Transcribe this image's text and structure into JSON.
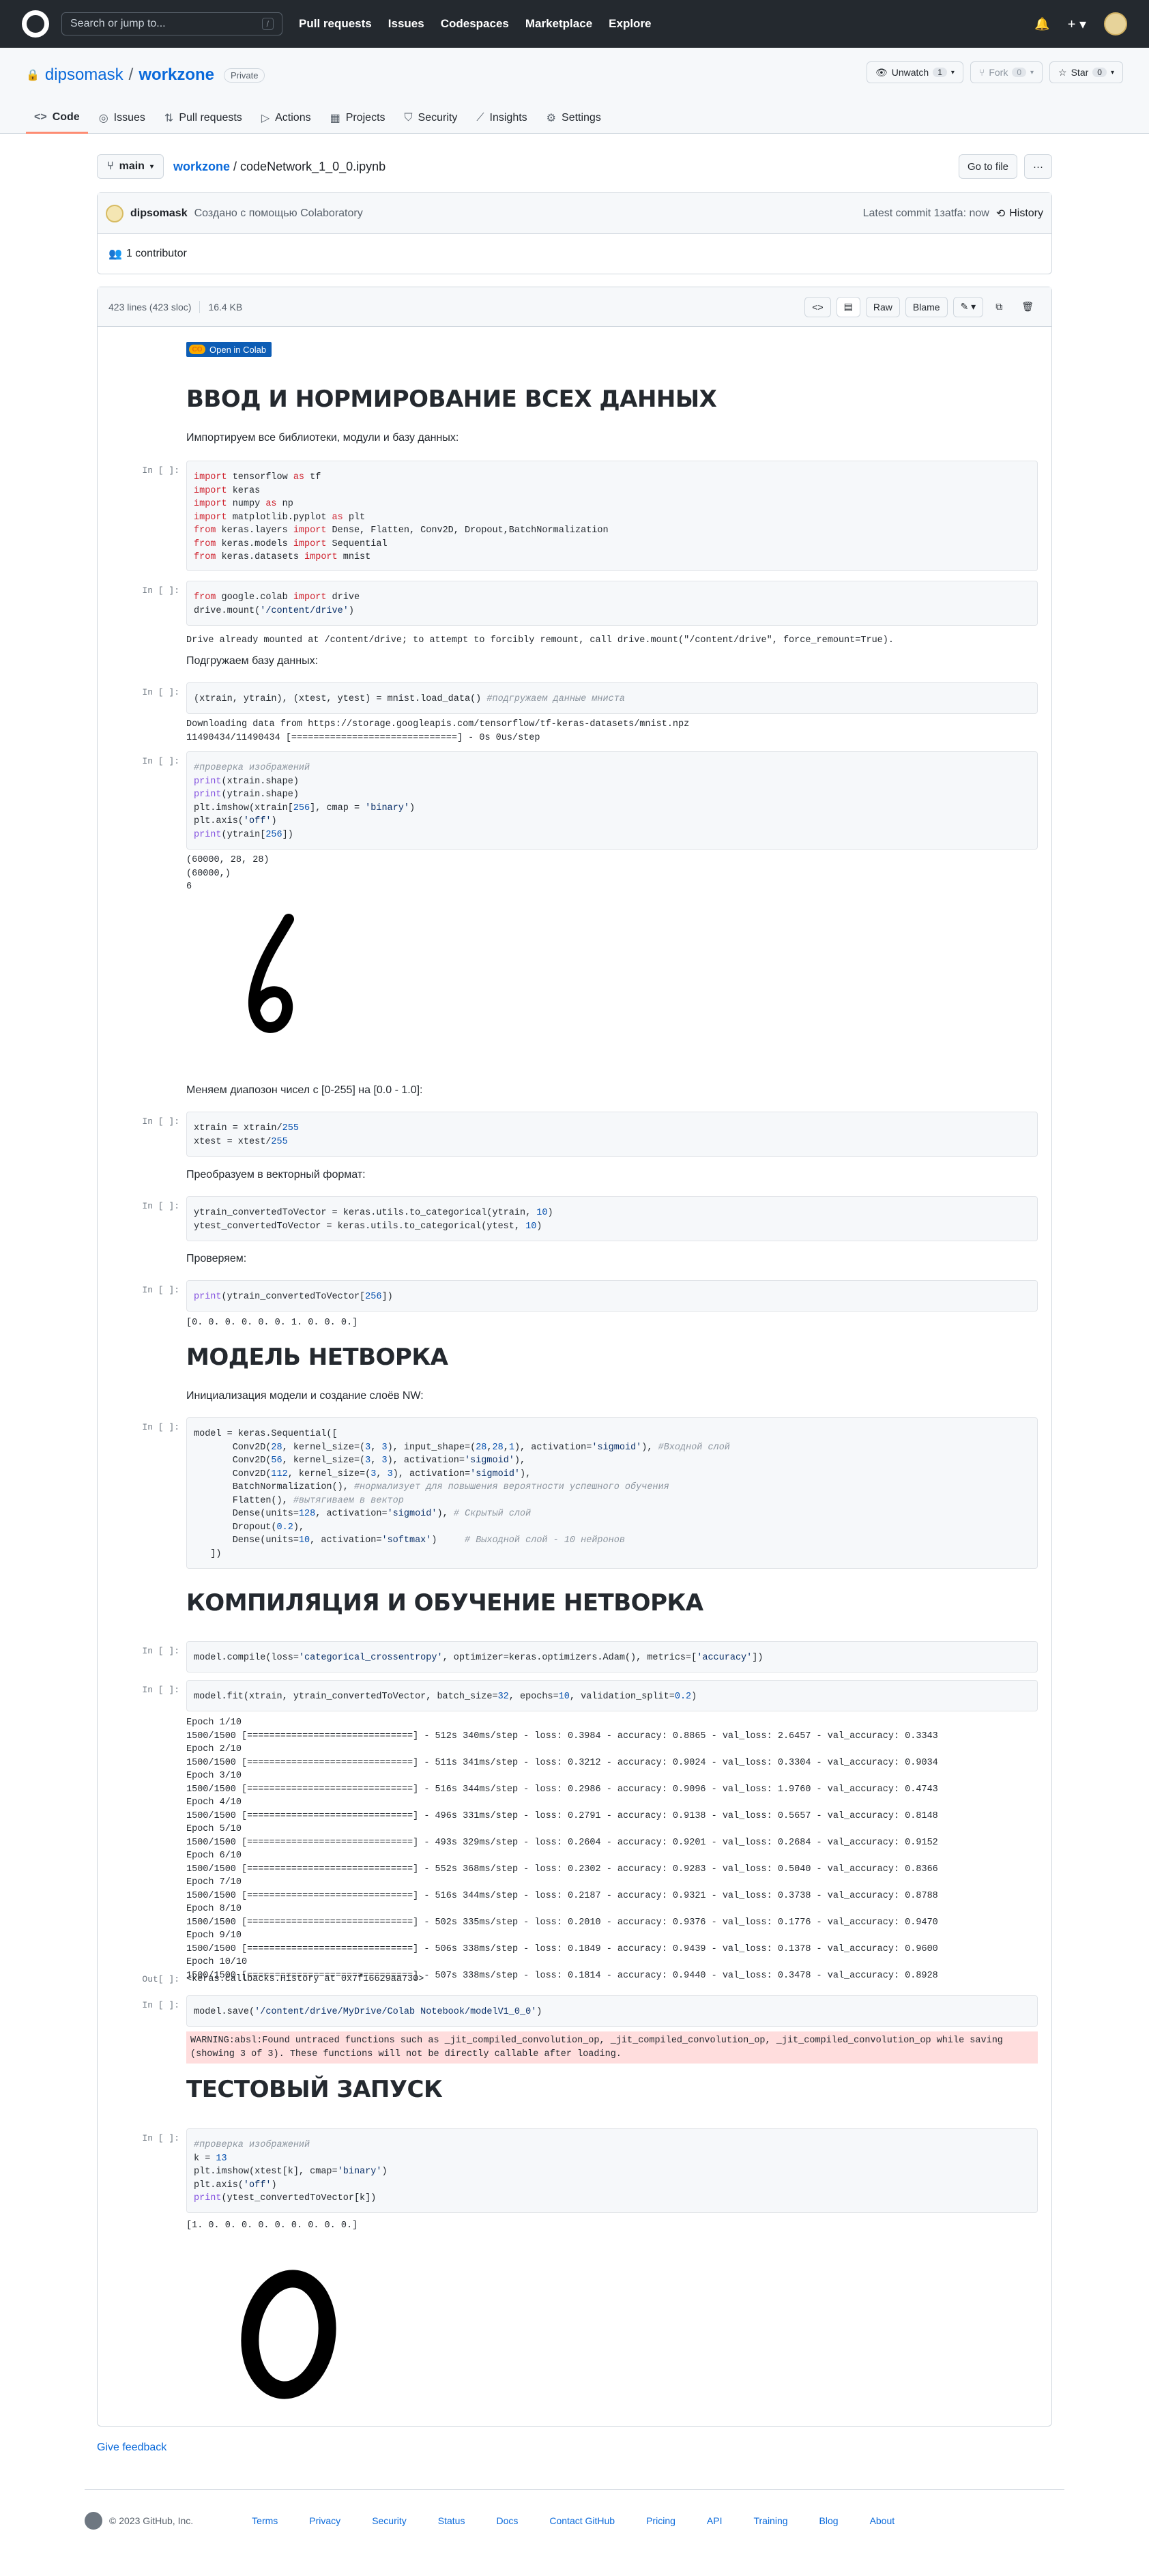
{
  "header": {
    "search_placeholder": "Search or jump to...",
    "search_shortcut": "/",
    "nav": [
      "Pull requests",
      "Issues",
      "Codespaces",
      "Marketplace",
      "Explore"
    ],
    "bell": "🔔",
    "plus": "+ ▾"
  },
  "repo": {
    "owner": "dipsomask",
    "separator": "/",
    "name": "workzone",
    "visibility": "Private",
    "unwatch_label": "Unwatch",
    "unwatch_count": "1",
    "fork_label": "Fork",
    "fork_count": "0",
    "star_label": "Star",
    "star_count": "0",
    "tabs": [
      "Code",
      "Issues",
      "Pull requests",
      "Actions",
      "Projects",
      "Security",
      "Insights",
      "Settings"
    ]
  },
  "file": {
    "branch": "main",
    "repo_link": "workzone",
    "filename": "codeNetwork_1_0_0.ipynb",
    "go_to_file": "Go to file",
    "more": "···",
    "commit_author": "dipsomask",
    "commit_message": "Создано с помощью Colaboratory",
    "latest_commit": "Latest commit 1зatfa: now",
    "history": "History",
    "contributors": "1 contributor",
    "lines": "423 lines (423 sloc)",
    "size": "16.4 KB",
    "raw": "Raw",
    "blame": "Blame"
  },
  "notebook": {
    "colab_badge": "Open in Colab",
    "h1": "ВВОД И НОРМИРОВАНИЕ ВСЕХ ДАННЫХ",
    "md1": "Импортируем все библиотеки, модули и базу данных:",
    "md2": "Подгружаем базу данных:",
    "md3": "Меняем диапозон чисел с [0-255] на [0.0 - 1.0]:",
    "md4": "Преобразуем в векторный формат:",
    "md5": "Проверяем:",
    "h2": "МОДЕЛЬ НЕТВОРКА",
    "md6": "Инициализация модели и создание слоёв NW:",
    "h3": "КОМПИЛЯЦИЯ И ОБУЧЕНИЕ НЕТВОРКА",
    "h4": "ТЕСТОВЫЙ ЗАПУСК",
    "prompt_in": "In [ ]:",
    "prompt_out": "Out[ ]:",
    "out_mount": "Drive already mounted at /content/drive; to attempt to forcibly remount, call drive.mount(\"/content/drive\", force_remount=True).",
    "out_download": "Downloading data from https://storage.googleapis.com/tensorflow/tf-keras-datasets/mnist.npz\n11490434/11490434 [==============================] - 0s 0us/step",
    "out_shapes": "(60000, 28, 28)\n(60000,)\n6",
    "out_vector": "[0. 0. 0. 0. 0. 0. 1. 0. 0. 0.]",
    "out_fit": "Epoch 1/10\n1500/1500 [==============================] - 512s 340ms/step - loss: 0.3984 - accuracy: 0.8865 - val_loss: 2.6457 - val_accuracy: 0.3343\nEpoch 2/10\n1500/1500 [==============================] - 511s 341ms/step - loss: 0.3212 - accuracy: 0.9024 - val_loss: 0.3304 - val_accuracy: 0.9034\nEpoch 3/10\n1500/1500 [==============================] - 516s 344ms/step - loss: 0.2986 - accuracy: 0.9096 - val_loss: 1.9760 - val_accuracy: 0.4743\nEpoch 4/10\n1500/1500 [==============================] - 496s 331ms/step - loss: 0.2791 - accuracy: 0.9138 - val_loss: 0.5657 - val_accuracy: 0.8148\nEpoch 5/10\n1500/1500 [==============================] - 493s 329ms/step - loss: 0.2604 - accuracy: 0.9201 - val_loss: 0.2684 - val_accuracy: 0.9152\nEpoch 6/10\n1500/1500 [==============================] - 552s 368ms/step - loss: 0.2302 - accuracy: 0.9283 - val_loss: 0.5040 - val_accuracy: 0.8366\nEpoch 7/10\n1500/1500 [==============================] - 516s 344ms/step - loss: 0.2187 - accuracy: 0.9321 - val_loss: 0.3738 - val_accuracy: 0.8788\nEpoch 8/10\n1500/1500 [==============================] - 502s 335ms/step - loss: 0.2010 - accuracy: 0.9376 - val_loss: 0.1776 - val_accuracy: 0.9470\nEpoch 9/10\n1500/1500 [==============================] - 506s 338ms/step - loss: 0.1849 - accuracy: 0.9439 - val_loss: 0.1378 - val_accuracy: 0.9600\nEpoch 10/10\n1500/1500 [==============================] - 507s 338ms/step - loss: 0.1814 - accuracy: 0.9440 - val_loss: 0.3478 - val_accuracy: 0.8928",
    "out_history": "<keras.callbacks.History at 0x7f16629aa730>",
    "out_warning": "WARNING:absl:Found untraced functions such as _jit_compiled_convolution_op, _jit_compiled_convolution_op, _jit_compiled_convolution_op while saving (showing 3 of 3). These functions will not be directly callable after loading.",
    "out_test": "[1. 0. 0. 0. 0. 0. 0. 0. 0. 0.]"
  },
  "footer": {
    "copyright": "© 2023 GitHub, Inc.",
    "links": [
      "Terms",
      "Privacy",
      "Security",
      "Status",
      "Docs",
      "Contact GitHub",
      "Pricing",
      "API",
      "Training",
      "Blog",
      "About"
    ],
    "give_feedback": "Give feedback"
  }
}
